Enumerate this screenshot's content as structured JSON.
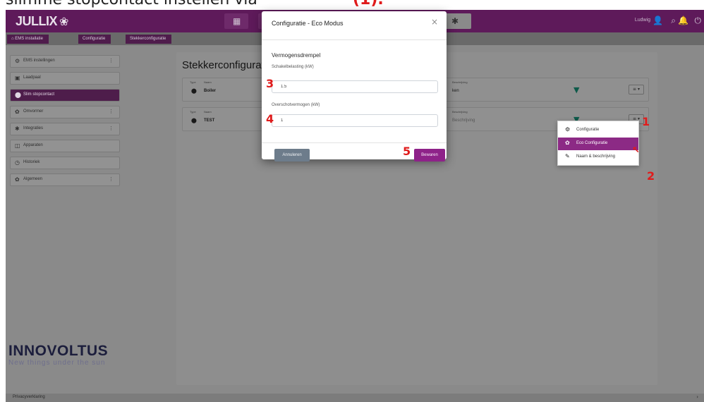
{
  "caption": {
    "text": "slimme stopcontact instellen via",
    "mark": "(1)."
  },
  "topbar": {
    "logo": "JULLIX",
    "logo_symbol": "❀",
    "user": "Ludwig",
    "icons": [
      "grid-icon",
      "user-icon",
      "search-icon",
      "bell-icon",
      "power-icon"
    ]
  },
  "breadcrumb": [
    "EMS installatie",
    "Configuratie",
    "Stekkerconfiguratie"
  ],
  "sidebar": {
    "items": [
      {
        "label": "EMS instellingen",
        "icon": "⚙",
        "more": "⋮",
        "active": false
      },
      {
        "label": "Laadpaal",
        "icon": "▣",
        "more": "",
        "active": false
      },
      {
        "label": "Slim stopcontact",
        "icon": "⬤",
        "more": "",
        "active": true
      },
      {
        "label": "Omvormer",
        "icon": "✿",
        "more": "⋮",
        "active": false
      },
      {
        "label": "Integraties",
        "icon": "✱",
        "more": "⋮",
        "active": false
      },
      {
        "label": "Apparaten",
        "icon": "◫",
        "more": "",
        "active": false
      },
      {
        "label": "Historiek",
        "icon": "◷",
        "more": "",
        "active": false
      },
      {
        "label": "Algemeen",
        "icon": "✿",
        "more": "⋮",
        "active": false
      }
    ]
  },
  "brand": {
    "name": "INNOVOLTUS",
    "tagline": "New things under the sun"
  },
  "footer": {
    "text": "Privacyverklaring",
    "arrow": "›"
  },
  "panel": {
    "title": "Stekkerconfiguratie",
    "rows": [
      {
        "type_label": "Type",
        "name_label": "Naam",
        "name": "Boiler",
        "desc_label": "Beschrijving",
        "desc": "ken",
        "menu": "≡ ▾"
      },
      {
        "type_label": "Type",
        "name_label": "Naam",
        "name": "TEST",
        "desc_label": "Beschrijving",
        "desc": "Beschrijving",
        "menu": "≡ ▾"
      }
    ]
  },
  "dropdown": {
    "items": [
      {
        "label": "Configuratie",
        "icon": "⚙",
        "active": false
      },
      {
        "label": "Eco Configuratie",
        "icon": "✿",
        "active": true
      },
      {
        "label": "Naam & beschrijving",
        "icon": "✎",
        "active": false
      }
    ]
  },
  "modal": {
    "title": "Configuratie - Eco Modus",
    "close": "×",
    "section": "Vermogensdrempel",
    "fields": [
      {
        "label": "Schakelbelasting (kW)",
        "value": "1.5"
      },
      {
        "label": "Overschotvermogen (kW)",
        "value": "1"
      }
    ],
    "cancel": "Annuleren",
    "save": "Bewaren"
  },
  "annotations": [
    "1",
    "2",
    "3",
    "4",
    "5"
  ],
  "colors": {
    "primary": "#5e1a5a",
    "accent": "#8e2289",
    "annotation": "#e01b1b"
  }
}
